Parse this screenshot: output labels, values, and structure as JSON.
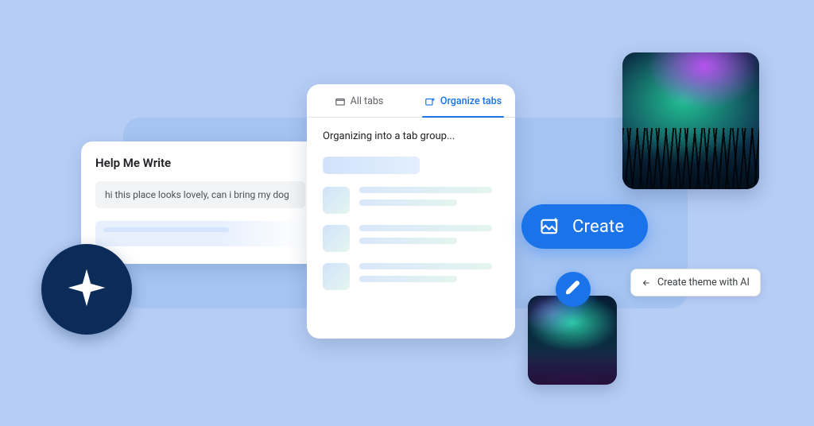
{
  "help_me_write": {
    "title": "Help Me Write",
    "prompt": "hi this place looks lovely, can i bring my dog"
  },
  "organize": {
    "tab_all": "All tabs",
    "tab_organize": "Organize tabs",
    "status": "Organizing into a tab group..."
  },
  "create_button": {
    "label": "Create"
  },
  "theme_chip": {
    "label": "Create theme with AI"
  },
  "icons": {
    "star_badge": "sparkle-star-icon",
    "edit": "pencil-icon",
    "tabs": "tabs-icon",
    "organize": "organize-sparkle-icon",
    "create_image": "image-sparkle-icon",
    "back_arrow": "arrow-left-icon"
  }
}
